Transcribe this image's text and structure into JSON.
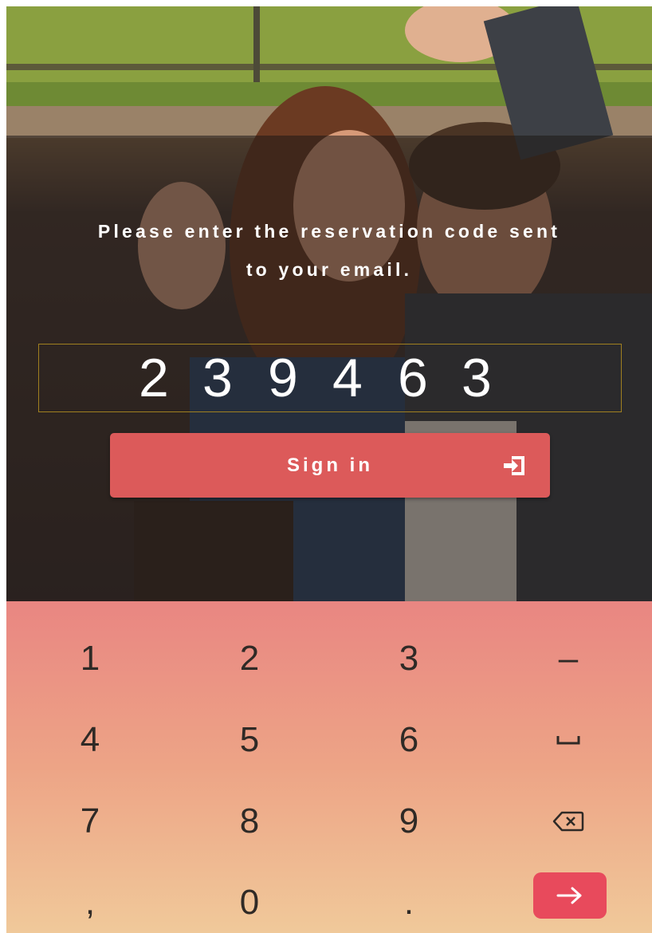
{
  "prompt": {
    "line1": "Please enter the reservation code sent",
    "line2": "to your email."
  },
  "code": {
    "value": "239463",
    "digits": [
      "2",
      "3",
      "9",
      "4",
      "6",
      "3"
    ]
  },
  "signin": {
    "label": "Sign in",
    "icon": "sign-in-icon"
  },
  "keyboard": {
    "row1": [
      "1",
      "2",
      "3",
      "–"
    ],
    "row2": [
      "4",
      "5",
      "6"
    ],
    "row2_icon": "space-icon",
    "row3": [
      "7",
      "8",
      "9"
    ],
    "row3_icon": "backspace-icon",
    "row4": [
      ",",
      "0",
      "."
    ],
    "row4_icon": "arrow-right-icon"
  },
  "colors": {
    "button": "#dc5a5a",
    "enter_key": "#e84a5c",
    "keyboard_top": "#e98682",
    "keyboard_bottom": "#f0c99a"
  }
}
